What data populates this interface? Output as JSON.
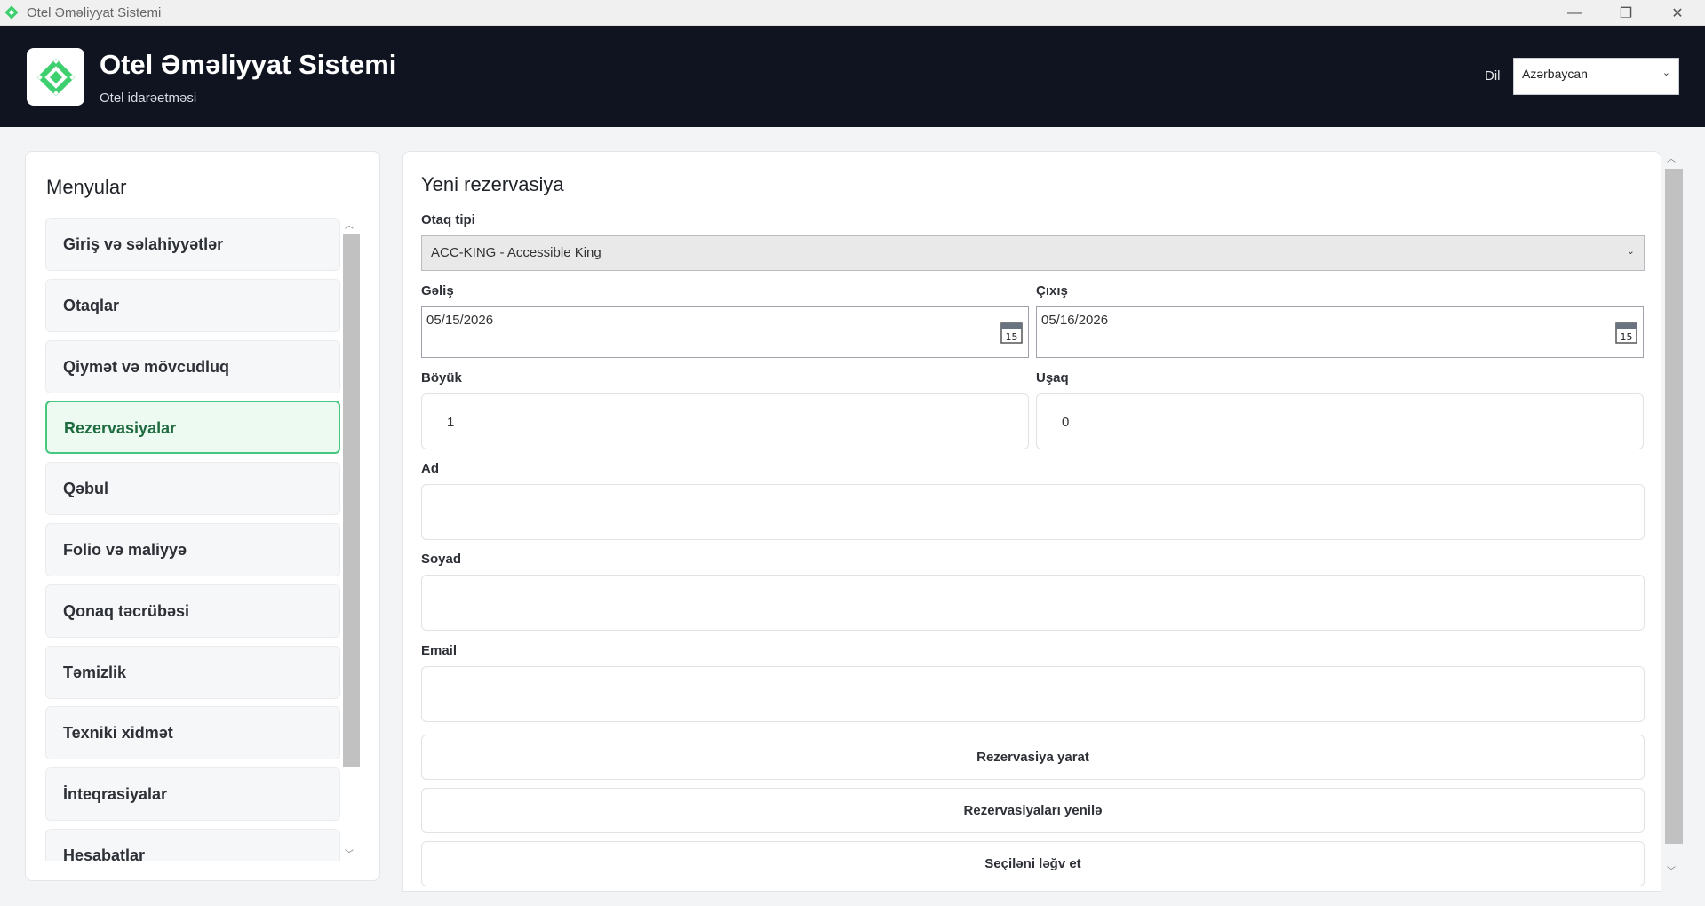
{
  "window": {
    "title": "Otel Əməliyyat Sistemi",
    "minimize": "—",
    "restore": "❐",
    "close": "✕"
  },
  "header": {
    "title": "Otel Əməliyyat Sistemi",
    "subtitle": "Otel idarəetməsi",
    "language_label": "Dil",
    "language_value": "Azərbaycan",
    "brand_color": "#3ecf6e"
  },
  "sidebar": {
    "title": "Menyular",
    "items": [
      {
        "label": "Giriş və səlahiyyətlər",
        "active": false
      },
      {
        "label": "Otaqlar",
        "active": false
      },
      {
        "label": "Qiymət və mövcudluq",
        "active": false
      },
      {
        "label": "Rezervasiyalar",
        "active": true
      },
      {
        "label": "Qəbul",
        "active": false
      },
      {
        "label": "Folio və maliyyə",
        "active": false
      },
      {
        "label": "Qonaq təcrübəsi",
        "active": false
      },
      {
        "label": "Təmizlik",
        "active": false
      },
      {
        "label": "Texniki xidmət",
        "active": false
      },
      {
        "label": "İnteqrasiyalar",
        "active": false
      },
      {
        "label": "Hesabatlar",
        "active": false
      }
    ]
  },
  "form": {
    "title": "Yeni rezervasiya",
    "room_type_label": "Otaq tipi",
    "room_type_value": "ACC-KING - Accessible King",
    "arrival_label": "Gəliş",
    "arrival_value": "05/15/2026",
    "departure_label": "Çıxış",
    "departure_value": "05/16/2026",
    "calendar_day": "15",
    "adults_label": "Böyük",
    "adults_value": "1",
    "children_label": "Uşaq",
    "children_value": "0",
    "first_name_label": "Ad",
    "last_name_label": "Soyad",
    "email_label": "Email",
    "create_button": "Rezervasiya yarat",
    "refresh_button": "Rezervasiyaları yenilə",
    "cancel_button": "Seçiləni ləğv et"
  }
}
